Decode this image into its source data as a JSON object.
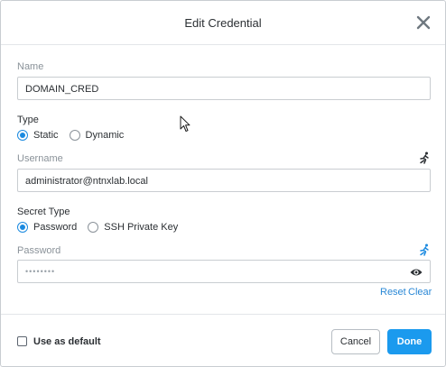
{
  "dialog": {
    "title": "Edit Credential"
  },
  "form": {
    "name_label": "Name",
    "name_value": "DOMAIN_CRED",
    "type_label": "Type",
    "type_options": [
      "Static",
      "Dynamic"
    ],
    "type_selected": "Static",
    "username_label": "Username",
    "username_value": "administrator@ntnxlab.local",
    "secret_type_label": "Secret Type",
    "secret_type_options": [
      "Password",
      "SSH Private Key"
    ],
    "secret_type_selected": "Password",
    "password_label": "Password",
    "password_mask": "••••••••",
    "reset_label": "Reset",
    "clear_label": "Clear"
  },
  "footer": {
    "default_label": "Use as default",
    "cancel_label": "Cancel",
    "done_label": "Done"
  },
  "colors": {
    "accent": "#1b9aee",
    "link": "#2a88d6",
    "text": "#2b2f33",
    "muted": "#8a9299"
  },
  "icons": {
    "close": "close-icon",
    "username_macro": "runner-icon",
    "password_macro": "runner-icon-blue",
    "password_reveal": "eye-icon"
  }
}
